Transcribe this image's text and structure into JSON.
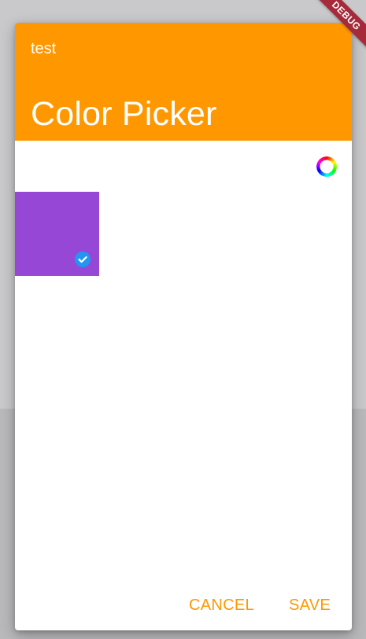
{
  "dialog": {
    "subtitle": "test",
    "title": "Color Picker"
  },
  "picker": {
    "selected_color": "#9747d6",
    "wheel_icon": "color-wheel-icon",
    "check_icon": "check-circle-icon"
  },
  "actions": {
    "cancel_label": "CANCEL",
    "save_label": "SAVE"
  },
  "debug_banner": {
    "label": "DEBUG"
  },
  "colors": {
    "accent": "#ff9800",
    "check_badge": "#2196f3"
  }
}
